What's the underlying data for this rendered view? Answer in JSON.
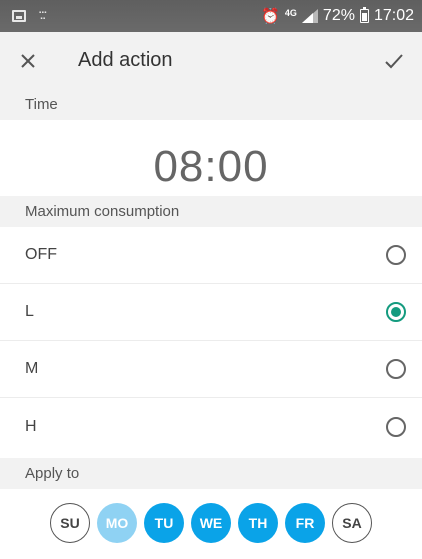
{
  "status_bar": {
    "network_label": "4G",
    "battery_percent": "72%",
    "time": "17:02",
    "icons": [
      "gallery-icon",
      "notification-icon",
      "alarm-icon",
      "signal-icon",
      "battery-icon"
    ]
  },
  "toolbar": {
    "title": "Add action",
    "close_icon": "close-icon",
    "confirm_icon": "check-icon"
  },
  "time_section": {
    "header": "Time",
    "value": "08:00"
  },
  "consumption_section": {
    "header": "Maximum consumption",
    "options": [
      {
        "label": "OFF",
        "selected": false
      },
      {
        "label": "L",
        "selected": true
      },
      {
        "label": "M",
        "selected": false
      },
      {
        "label": "H",
        "selected": false
      }
    ]
  },
  "apply_section": {
    "header": "Apply to",
    "days": [
      {
        "label": "SU",
        "state": "off"
      },
      {
        "label": "MO",
        "state": "light"
      },
      {
        "label": "TU",
        "state": "on"
      },
      {
        "label": "WE",
        "state": "on"
      },
      {
        "label": "TH",
        "state": "on"
      },
      {
        "label": "FR",
        "state": "on"
      },
      {
        "label": "SA",
        "state": "off"
      }
    ]
  },
  "colors": {
    "accent_radio": "#149b7f",
    "day_selected": "#0aa3e8",
    "day_light": "#8fd2f3",
    "header_bg": "#f2f2f2"
  }
}
